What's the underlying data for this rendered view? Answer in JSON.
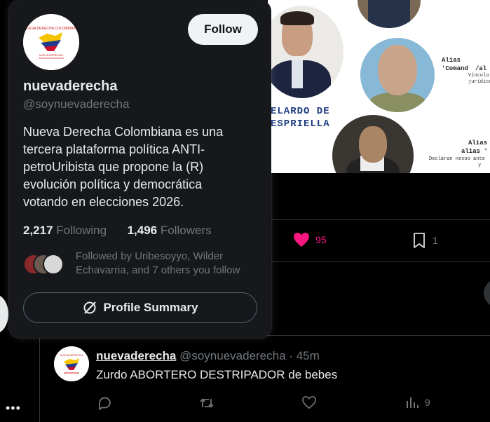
{
  "hover_card": {
    "display_name": "nuevaderecha",
    "handle": "@soynuevaderecha",
    "follow_label": "Follow",
    "bio": "Nueva Derecha Colombiana es una tercera plataforma política ANTI-petroUribista que propone la (R) evolución política y democrática votando en elecciones 2026.",
    "following_count": "2,217",
    "following_label": "Following",
    "followers_count": "1,496",
    "followers_label": "Followers",
    "followed_by": "Followed by Uribesoyyo, Wilder Echavarria, and 7 others you follow",
    "profile_summary_label": "Profile Summary"
  },
  "media": {
    "name_line1": "ELARDO DE",
    "name_line2": "ESPRIELLA",
    "alias_top": "Alias 'Comand",
    "alias_top2": "/al",
    "alias_top_note1": "Vínculo",
    "alias_top_note2": "jurídicos",
    "alias_bottom": "Alias",
    "alias_bottom2": "alias '",
    "alias_bottom_note1": "Declaran nexos ante",
    "alias_bottom_note2": "y"
  },
  "tweet_actions": {
    "like_count": "95",
    "bookmark_count": "1"
  },
  "reply_tweet": {
    "name": "nuevaderecha",
    "handle": "@soynuevaderecha",
    "separator": "·",
    "time": "45m",
    "text": "Zurdo ABORTERO DESTRIPADOR de bebes",
    "views_count": "9"
  },
  "more_label": "•••",
  "colors": {
    "like_pink": "#f91880",
    "muted": "#71767b",
    "card_bg": "#16181c",
    "background": "#000000"
  }
}
